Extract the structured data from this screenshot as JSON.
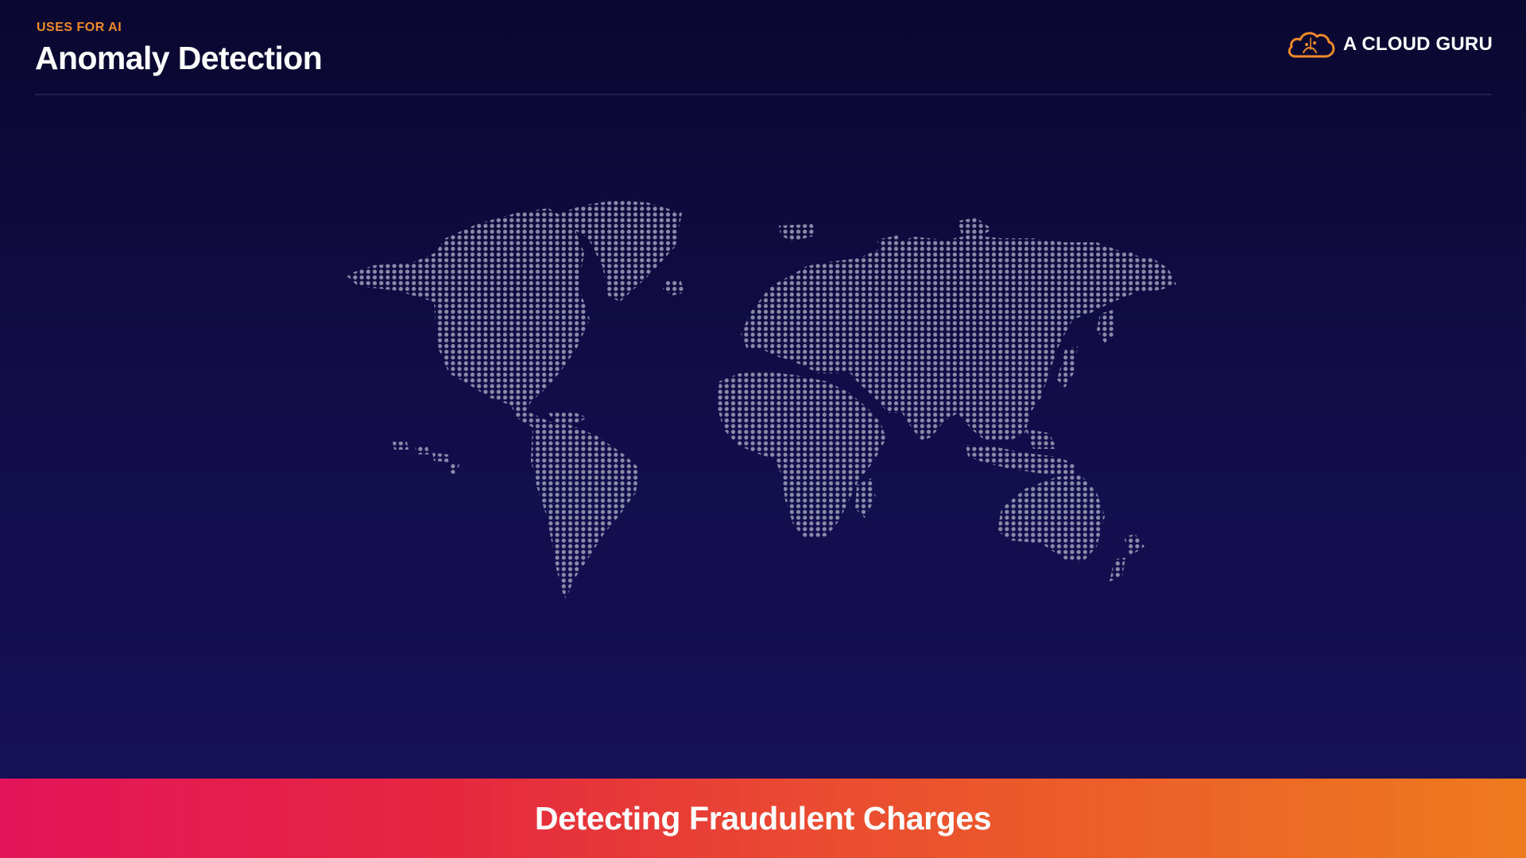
{
  "header": {
    "eyebrow": "USES FOR AI",
    "title": "Anomaly Detection"
  },
  "brand": {
    "name": "A CLOUD GURU",
    "logo_icon": "cloud-logo-icon",
    "logo_color": "#f08a2a"
  },
  "map": {
    "style": "dotted-world-map",
    "dot_color": "#8c8aaa"
  },
  "banner": {
    "text": "Detecting Fraudulent Charges",
    "gradient_start": "#e3145a",
    "gradient_end": "#ee7a1e"
  }
}
